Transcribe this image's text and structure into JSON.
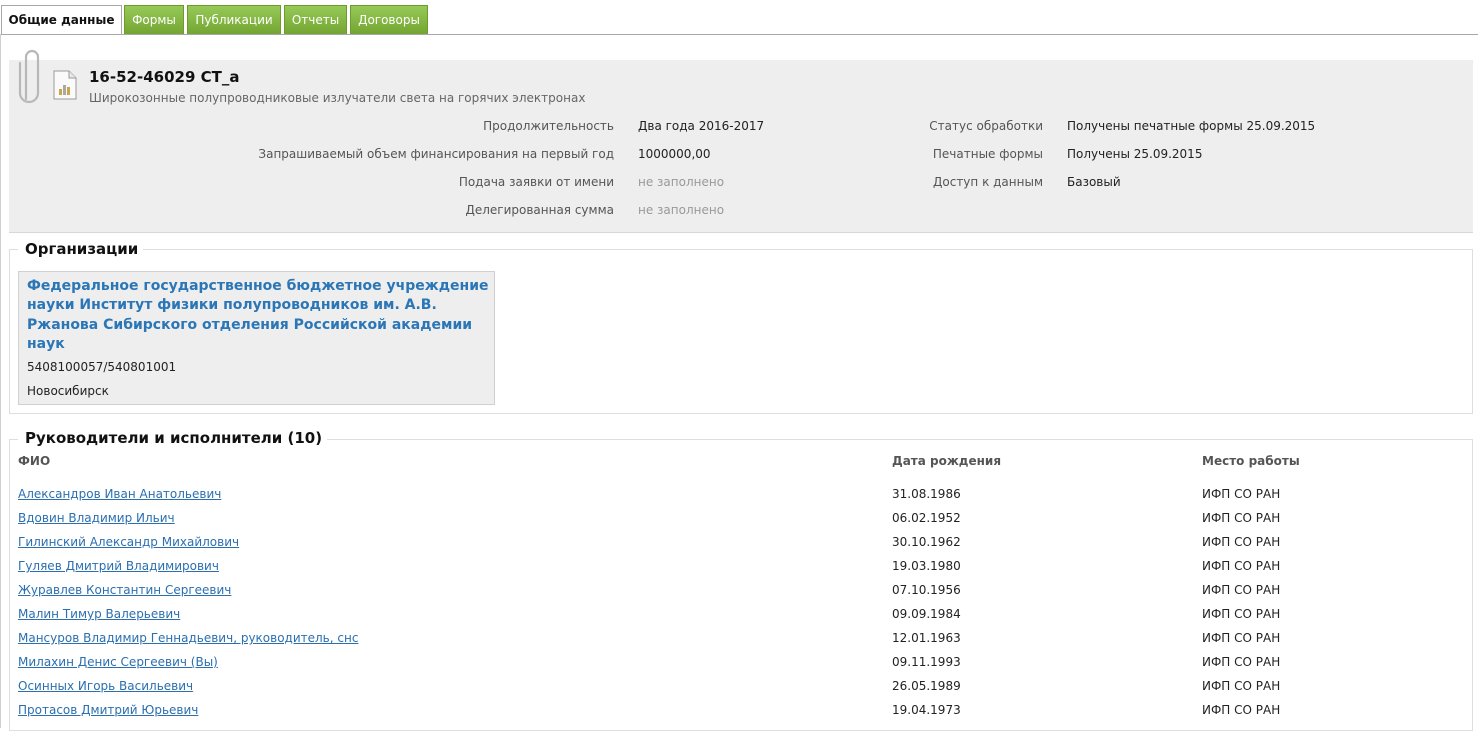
{
  "tabs": [
    {
      "label": "Общие данные",
      "active": true
    },
    {
      "label": "Формы",
      "active": false
    },
    {
      "label": "Публикации",
      "active": false
    },
    {
      "label": "Отчеты",
      "active": false
    },
    {
      "label": "Договоры",
      "active": false
    }
  ],
  "project": {
    "code": "16-52-46029 СТ_а",
    "title": "Широкозонные полупроводниковые излучатели света на горячих электронах"
  },
  "details_left": [
    {
      "label": "Продолжительность",
      "value": "Два года 2016-2017",
      "empty": false
    },
    {
      "label": "Запрашиваемый объем финансирования на первый год",
      "value": "1000000,00",
      "empty": false
    },
    {
      "label": "Подача заявки от имени",
      "value": "не заполнено",
      "empty": true
    },
    {
      "label": "Делегированная сумма",
      "value": "не заполнено",
      "empty": true
    }
  ],
  "details_right": [
    {
      "label": "Статус обработки",
      "value": "Получены печатные формы 25.09.2015"
    },
    {
      "label": "Печатные формы",
      "value": "Получены 25.09.2015"
    },
    {
      "label": "Доступ к данным",
      "value": "Базовый"
    }
  ],
  "organizations": {
    "title": "Организации",
    "items": [
      {
        "name": "Федеральное государственное бюджетное учреждение науки Институт физики полупроводников им. А.В. Ржанова Сибирского отделения Российской академии наук",
        "inn": "5408100057/540801001",
        "city": "Новосибирск"
      }
    ]
  },
  "people": {
    "title": "Руководители и исполнители (10)",
    "columns": [
      "ФИО",
      "Дата рождения",
      "Место работы"
    ],
    "rows": [
      {
        "name": "Александров Иван Анатольевич",
        "birth": "31.08.1986",
        "work": "ИФП СО РАН"
      },
      {
        "name": "Вдовин Владимир Ильич",
        "birth": "06.02.1952",
        "work": "ИФП СО РАН"
      },
      {
        "name": "Гилинский Александр Михайлович",
        "birth": "30.10.1962",
        "work": "ИФП СО РАН"
      },
      {
        "name": "Гуляев Дмитрий Владимирович",
        "birth": "19.03.1980",
        "work": "ИФП СО РАН"
      },
      {
        "name": "Журавлев Константин Сергеевич",
        "birth": "07.10.1956",
        "work": "ИФП СО РАН"
      },
      {
        "name": "Малин Тимур Валерьевич",
        "birth": "09.09.1984",
        "work": "ИФП СО РАН"
      },
      {
        "name": "Мансуров Владимир Геннадьевич, руководитель, снс",
        "birth": "12.01.1963",
        "work": "ИФП СО РАН"
      },
      {
        "name": "Милахин Денис Сергеевич (Вы)",
        "birth": "09.11.1993",
        "work": "ИФП СО РАН"
      },
      {
        "name": "Осинных Игорь Васильевич",
        "birth": "26.05.1989",
        "work": "ИФП СО РАН"
      },
      {
        "name": "Протасов Дмитрий Юрьевич",
        "birth": "19.04.1973",
        "work": "ИФП СО РАН"
      }
    ]
  },
  "colors": {
    "tab_green": "#7fb23f",
    "link": "#2a6fb0",
    "org_link": "#2a76b7",
    "panel_bg": "#eeeeee"
  },
  "icons": {
    "attachment": "paperclip-icon",
    "document": "document-icon"
  }
}
